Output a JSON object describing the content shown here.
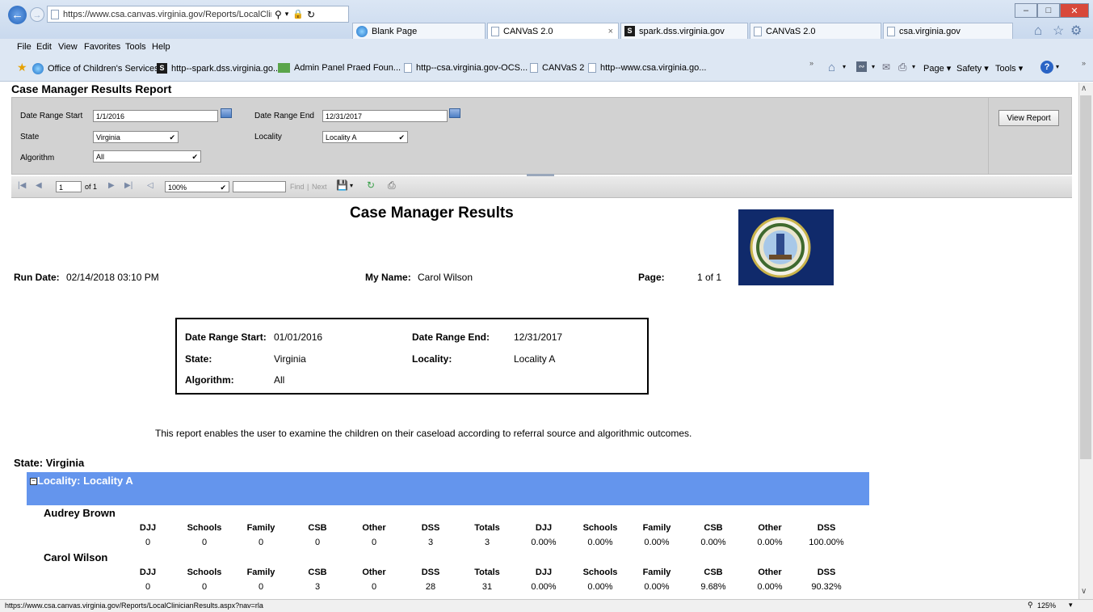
{
  "browser": {
    "address_url": "https://www.csa.canvas.virginia.gov/Reports/LocalClinicianI",
    "tabs": [
      {
        "label": "Blank Page"
      },
      {
        "label": "CANVaS 2.0"
      },
      {
        "label": "spark.dss.virginia.gov"
      },
      {
        "label": "CANVaS 2.0"
      },
      {
        "label": "csa.virginia.gov"
      }
    ],
    "menu": [
      "File",
      "Edit",
      "View",
      "Favorites",
      "Tools",
      "Help"
    ],
    "favorites": [
      "Office of Children's Services",
      "http--spark.dss.virginia.go...",
      "Admin Panel  Praed Foun...",
      "http--csa.virginia.gov-OCS...",
      "CANVaS 2",
      "http--www.csa.virginia.go..."
    ],
    "command_bar": {
      "page": "Page",
      "safety": "Safety",
      "tools": "Tools"
    },
    "status_url": "https://www.csa.canvas.virginia.gov/Reports/LocalClinicianResults.aspx?nav=rla",
    "zoom": "125%"
  },
  "viewer": {
    "title": "Case Manager Results Report",
    "params": {
      "date_start_label": "Date Range Start",
      "date_start_value": "1/1/2016",
      "date_end_label": "Date Range End",
      "date_end_value": "12/31/2017",
      "state_label": "State",
      "state_value": "Virginia",
      "locality_label": "Locality",
      "locality_value": "Locality A",
      "algorithm_label": "Algorithm",
      "algorithm_value": "All",
      "view_report": "View Report"
    },
    "toolbar": {
      "page_value": "1",
      "of_pages": "of 1",
      "zoom": "100%",
      "find": "Find",
      "sep": "|",
      "next": "Next"
    }
  },
  "report": {
    "heading": "Case Manager Results",
    "run_date_label": "Run Date:",
    "run_date_value": "02/14/2018 03:10 PM",
    "my_name_label": "My Name:",
    "my_name_value": "Carol Wilson",
    "page_label": "Page:",
    "page_value": "1 of 1",
    "box": {
      "start_label": "Date Range Start:",
      "start_value": "01/01/2016",
      "end_label": "Date Range End:",
      "end_value": "12/31/2017",
      "state_label": "State:",
      "state_value": "Virginia",
      "locality_label": "Locality:",
      "locality_value": "Locality A",
      "algorithm_label": "Algorithm:",
      "algorithm_value": "All"
    },
    "description": "This report enables the user to examine the children on their caseload according to referral source and algorithmic outcomes.",
    "state_group": "State:  Virginia",
    "locality_group": "Locality:  Locality A",
    "columns": [
      "DJJ",
      "Schools",
      "Family",
      "CSB",
      "Other",
      "DSS",
      "Totals",
      "DJJ",
      "Schools",
      "Family",
      "CSB",
      "Other",
      "DSS"
    ],
    "managers": [
      {
        "name": "Audrey Brown",
        "values": [
          "0",
          "0",
          "0",
          "0",
          "0",
          "3",
          "3",
          "0.00%",
          "0.00%",
          "0.00%",
          "0.00%",
          "0.00%",
          "100.00%"
        ]
      },
      {
        "name": "Carol Wilson",
        "values": [
          "0",
          "0",
          "0",
          "3",
          "0",
          "28",
          "31",
          "0.00%",
          "0.00%",
          "0.00%",
          "9.68%",
          "0.00%",
          "90.32%"
        ]
      }
    ]
  }
}
